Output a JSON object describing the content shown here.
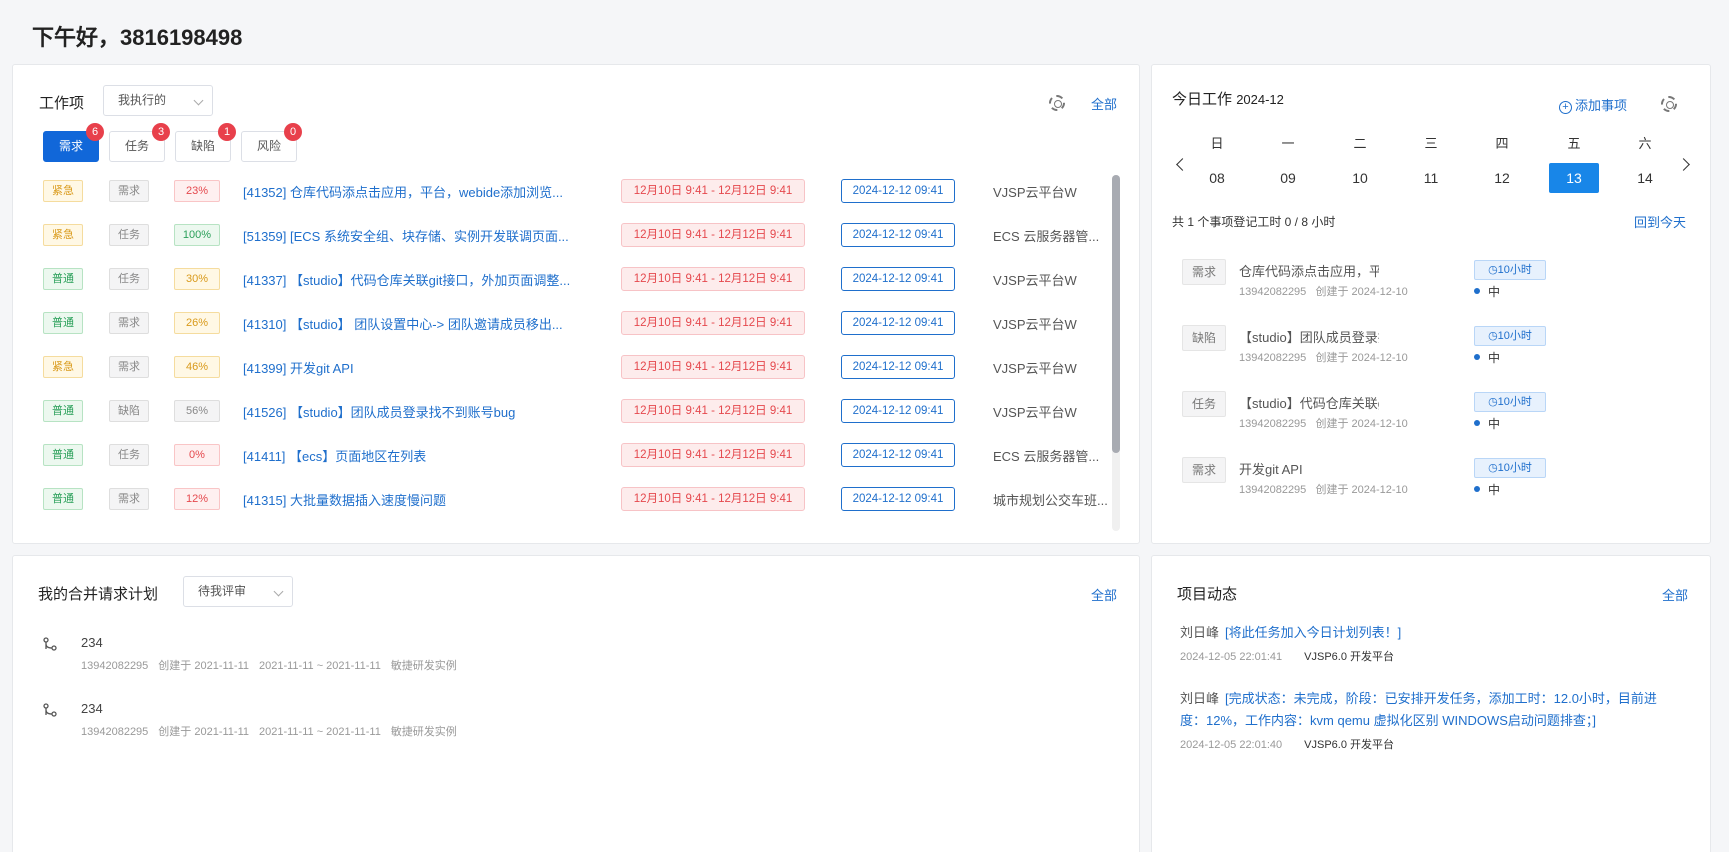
{
  "greeting": "下午好，3816198498",
  "work": {
    "title": "工作项",
    "filter": "我执行的",
    "all_link": "全部",
    "tabs": [
      {
        "label": "需求",
        "count": "6"
      },
      {
        "label": "任务",
        "count": "3"
      },
      {
        "label": "缺陷",
        "count": "1"
      },
      {
        "label": "风险",
        "count": "0"
      }
    ],
    "rows": [
      {
        "priority": "紧急",
        "type": "需求",
        "progress": "23%",
        "title": "[41352] 仓库代码添点击应用，平台，webide添加浏览...",
        "range": "12月10日 9:41 - 12月12日 9:41",
        "due": "2024-12-12 09:41",
        "project": "VJSP云平台W"
      },
      {
        "priority": "紧急",
        "type": "任务",
        "progress": "100%",
        "title": "[51359] [ECS 系统安全组、块存储、实例开发联调页面...",
        "range": "12月10日 9:41 - 12月12日 9:41",
        "due": "2024-12-12 09:41",
        "project": "ECS 云服务器管..."
      },
      {
        "priority": "普通",
        "type": "任务",
        "progress": "30%",
        "title": "[41337] 【studio】代码仓库关联git接口，外加页面调整...",
        "range": "12月10日 9:41 - 12月12日 9:41",
        "due": "2024-12-12 09:41",
        "project": "VJSP云平台W"
      },
      {
        "priority": "普通",
        "type": "需求",
        "progress": "26%",
        "title": "[41310] 【studio】 团队设置中心-> 团队邀请成员移出...",
        "range": "12月10日 9:41 - 12月12日 9:41",
        "due": "2024-12-12 09:41",
        "project": "VJSP云平台W"
      },
      {
        "priority": "紧急",
        "type": "需求",
        "progress": "46%",
        "title": "[41399] 开发git API",
        "range": "12月10日 9:41 - 12月12日 9:41",
        "due": "2024-12-12 09:41",
        "project": "VJSP云平台W"
      },
      {
        "priority": "普通",
        "type": "缺陷",
        "progress": "56%",
        "title": "[41526] 【studio】团队成员登录找不到账号bug",
        "range": "12月10日 9:41 - 12月12日 9:41",
        "due": "2024-12-12 09:41",
        "project": "VJSP云平台W"
      },
      {
        "priority": "普通",
        "type": "任务",
        "progress": "0%",
        "title": "[41411] 【ecs】页面地区在列表",
        "range": "12月10日 9:41 - 12月12日 9:41",
        "due": "2024-12-12 09:41",
        "project": "ECS 云服务器管..."
      },
      {
        "priority": "普通",
        "type": "需求",
        "progress": "12%",
        "title": "[41315] 大批量数据插入速度慢问题",
        "range": "12月10日 9:41 - 12月12日 9:41",
        "due": "2024-12-12 09:41",
        "project": "城市规划公交车班..."
      }
    ]
  },
  "today": {
    "title": "今日工作",
    "month": "2024-12",
    "add_label": "添加事项",
    "weekdays": [
      "日",
      "一",
      "二",
      "三",
      "四",
      "五",
      "六"
    ],
    "dates": [
      "08",
      "09",
      "10",
      "11",
      "12",
      "13",
      "14"
    ],
    "selected_date": "13",
    "summary": "共 1 个事项登记工时 0 / 8 小时",
    "back_today": "回到今天",
    "items": [
      {
        "type": "需求",
        "name": "仓库代码添点击应用，平台，webide",
        "user": "13942082295",
        "created": "创建于 2024-12-10",
        "hours": "10小时",
        "level": "中"
      },
      {
        "type": "缺陷",
        "name": "【studio】团队成员登录找不到账号",
        "user": "13942082295",
        "created": "创建于 2024-12-10",
        "hours": "10小时",
        "level": "中"
      },
      {
        "type": "任务",
        "name": "【studio】代码仓库关联git接口",
        "user": "13942082295",
        "created": "创建于 2024-12-10",
        "hours": "10小时",
        "level": "中"
      },
      {
        "type": "需求",
        "name": "开发git API",
        "user": "13942082295",
        "created": "创建于 2024-12-10",
        "hours": "10小时",
        "level": "中"
      }
    ]
  },
  "merge": {
    "title": "我的合并请求计划",
    "filter": "待我评审",
    "all_link": "全部",
    "items": [
      {
        "title": "234",
        "user": "13942082295",
        "created": "创建于 2021-11-11",
        "range": "2021-11-11 ~ 2021-11-11",
        "project": "敏捷研发实例"
      },
      {
        "title": "234",
        "user": "13942082295",
        "created": "创建于 2021-11-11",
        "range": "2021-11-11 ~ 2021-11-11",
        "project": "敏捷研发实例"
      }
    ]
  },
  "news": {
    "title": "项目动态",
    "all_link": "全部",
    "items": [
      {
        "user": "刘日峰",
        "action": "[将此任务加入今日计划列表！]",
        "time": "2024-12-05 22:01:41",
        "platform": "VJSP6.0 开发平台"
      },
      {
        "user": "刘日峰",
        "action": "[完成状态：未完成，阶段：已安排开发任务，添加工时：12.0小时，目前进度：12%，工作内容：kvm qemu 虚拟化区别 WINDOWS启动问题排查；]",
        "time": "2024-12-05 22:01:40",
        "platform": "VJSP6.0 开发平台"
      }
    ]
  }
}
